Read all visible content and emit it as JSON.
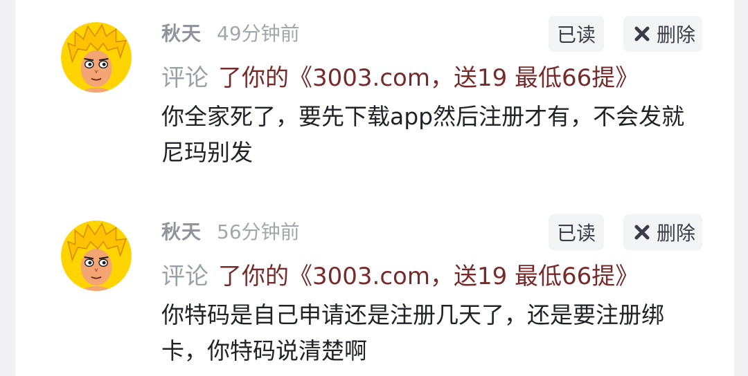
{
  "comments": [
    {
      "user": "秋天",
      "time": "49分钟前",
      "read_label": "已读",
      "delete_label": "删除",
      "action_verb": "评论",
      "post_title": "了你的《3003.com，送19 最低66提》",
      "body": "你全家死了，要先下载app然后注册才有，不会发就尼玛别发"
    },
    {
      "user": "秋天",
      "time": "56分钟前",
      "read_label": "已读",
      "delete_label": "删除",
      "action_verb": "评论",
      "post_title": "了你的《3003.com，送19 最低66提》",
      "body": "你特码是自己申请还是注册几天了，还是要注册绑卡，你特码说清楚啊"
    }
  ],
  "colors": {
    "title_link": "#762a2a",
    "muted": "#9aa0a8",
    "button_bg": "#f3f4f6",
    "page_bg": "#f1f1f3"
  },
  "icons": {
    "avatar": "cartoon-blond-avatar",
    "delete": "close-icon"
  }
}
